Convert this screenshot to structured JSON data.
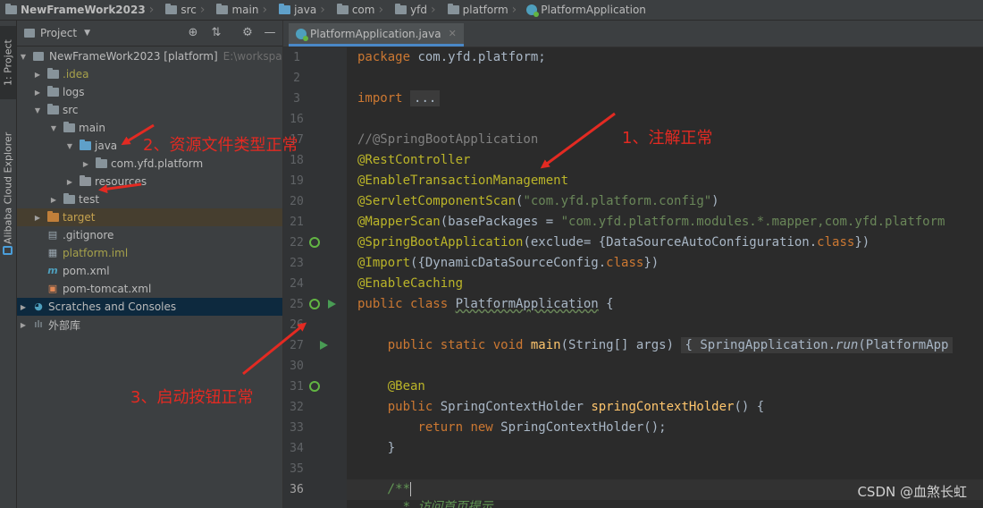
{
  "breadcrumb": [
    "NewFrameWork2023",
    "src",
    "main",
    "java",
    "com",
    "yfd",
    "platform",
    "PlatformApplication"
  ],
  "left_tabs": {
    "project": "1: Project",
    "cloud": "Alibaba Cloud Explorer"
  },
  "project_panel": {
    "title": "Project",
    "dropdown_icon": "chevron-down-icon"
  },
  "tree": {
    "root": {
      "name": "NewFrameWork2023 [platform]",
      "path": "E:\\workspa"
    },
    "items": {
      "idea": ".idea",
      "logs": "logs",
      "src": "src",
      "main": "main",
      "java": "java",
      "pkg": "com.yfd.platform",
      "resources": "resources",
      "test": "test",
      "target": "target",
      "gitignore": ".gitignore",
      "iml": "platform.iml",
      "pom": "pom.xml",
      "pomtomcat": "pom-tomcat.xml",
      "scratches": "Scratches and Consoles",
      "extlib": "外部库"
    }
  },
  "editor": {
    "tab_label": "PlatformApplication.java",
    "line_numbers": [
      "1",
      "2",
      "3",
      "16",
      "17",
      "18",
      "19",
      "20",
      "21",
      "22",
      "23",
      "24",
      "25",
      "26",
      "27",
      "30",
      "31",
      "32",
      "33",
      "34",
      "35",
      "36"
    ],
    "lines": {
      "l1": "com.yfd.platform;",
      "l3_fold": "...",
      "l17": "//@SpringBootApplication",
      "l18": "@RestController",
      "l19": "@EnableTransactionManagement",
      "l20_ann": "@ServletComponentScan",
      "l20_str": "\"com.yfd.platform.config\"",
      "l21_ann": "@MapperScan",
      "l21_param": "basePackages = ",
      "l21_str": "\"com.yfd.platform.modules.*.mapper,com.yfd.platform",
      "l22_ann": "@SpringBootApplication",
      "l22_rest": "(exclude= {DataSourceAutoConfiguration.",
      "l22_end": "})",
      "l23_ann": "@Import",
      "l23_rest": "({DynamicDataSourceConfig.",
      "l23_end": "})",
      "l24": "@EnableCaching",
      "l25_name": "PlatformApplication",
      "l25_end": " {",
      "l27_fn": "main",
      "l27_args": "(String[] args)",
      "l27_fold": "{ SpringApplication.",
      "l27_run": "run",
      "l27_tail": "(PlatformApp",
      "l31": "@Bean",
      "l32_type": " SpringContextHolder ",
      "l32_fn": "springContextHolder",
      "l32_end": "() {",
      "l33_rest": " SpringContextHolder();",
      "l34": "}",
      "l36": "/**",
      "l37": " * 访问首页提示"
    }
  },
  "annotations": {
    "a1": "1、注解正常",
    "a2": "2、资源文件类型正常",
    "a3": "3、启动按钮正常",
    "color": "#e32a22"
  },
  "watermark": "CSDN @血煞长虹"
}
